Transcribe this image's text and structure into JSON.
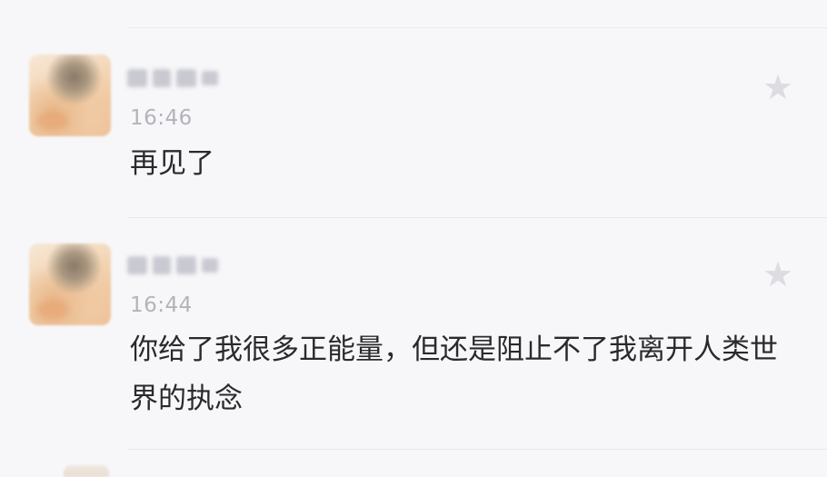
{
  "colors": {
    "background": "#f7f7f9",
    "message_text": "#2a2a2c",
    "time_text": "#b3b3bb",
    "star_inactive": "#dcdce1"
  },
  "messages": [
    {
      "nickname": "",
      "time": "16:46",
      "text": "再见了",
      "star_icon": "star-icon",
      "starred": false
    },
    {
      "nickname": "",
      "time": "16:44",
      "text": "你给了我很多正能量，但还是阻止不了我离开人类世界的执念",
      "star_icon": "star-icon",
      "starred": false
    }
  ]
}
